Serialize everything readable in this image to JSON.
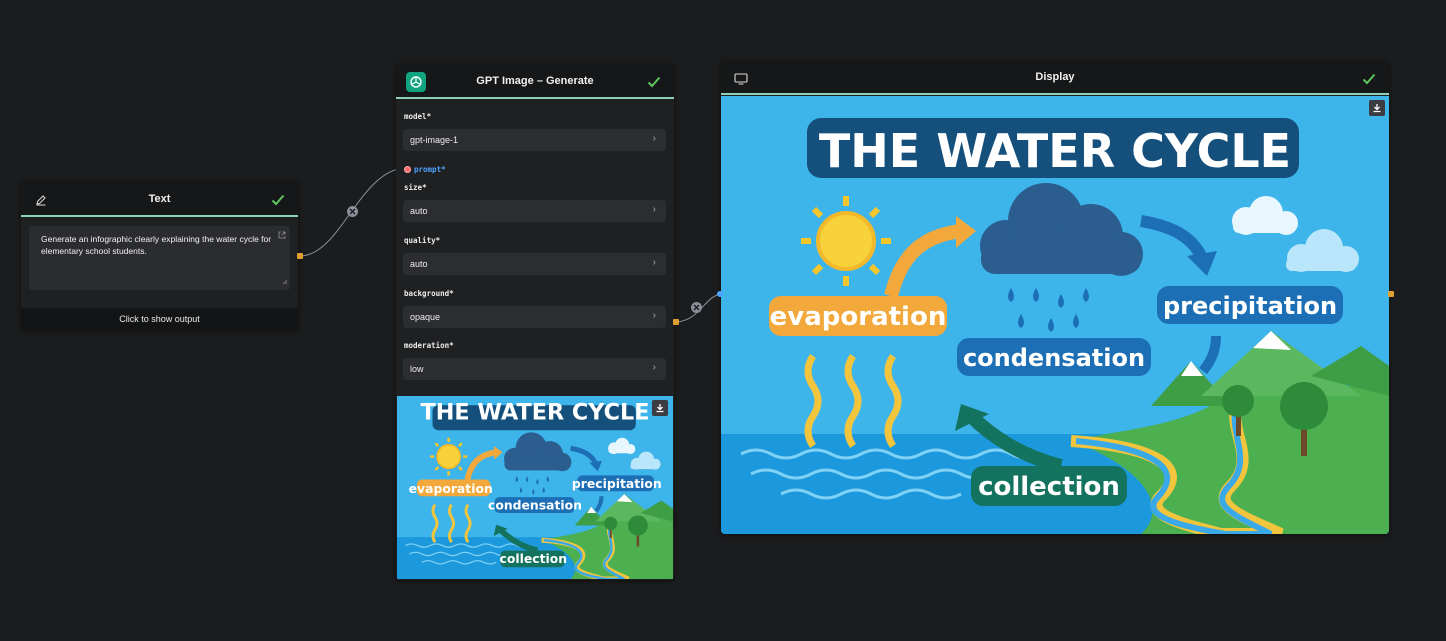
{
  "text_node": {
    "title": "Text",
    "icon": "pencil-icon",
    "content": "Generate an infographic clearly explaining the water cycle for elementary school students.",
    "show_output_label": "Click to show output"
  },
  "gpt_node": {
    "title": "GPT Image – Generate",
    "icon": "openai-icon",
    "params": [
      {
        "label": "model",
        "required": "*",
        "value": "gpt-image-1"
      },
      {
        "label": "prompt",
        "required": "*"
      },
      {
        "label": "size",
        "required": "*",
        "value": "auto"
      },
      {
        "label": "quality",
        "required": "*",
        "value": "auto"
      },
      {
        "label": "background",
        "required": "*",
        "value": "opaque"
      },
      {
        "label": "moderation",
        "required": "*",
        "value": "low"
      }
    ]
  },
  "display_node": {
    "title": "Display",
    "icon": "monitor-icon"
  },
  "infographic": {
    "title": "THE WATER CYCLE",
    "evaporation": "evaporation",
    "condensation": "condensation",
    "precipitation": "precipitation",
    "collection": "collection"
  },
  "colors": {
    "canvas": "#1b1c1d",
    "node_bg": "#1f2022",
    "header_accent": "#8ed0b8",
    "check": "#5ec45e",
    "port": "#e0a030",
    "sky": "#3db4ea"
  }
}
